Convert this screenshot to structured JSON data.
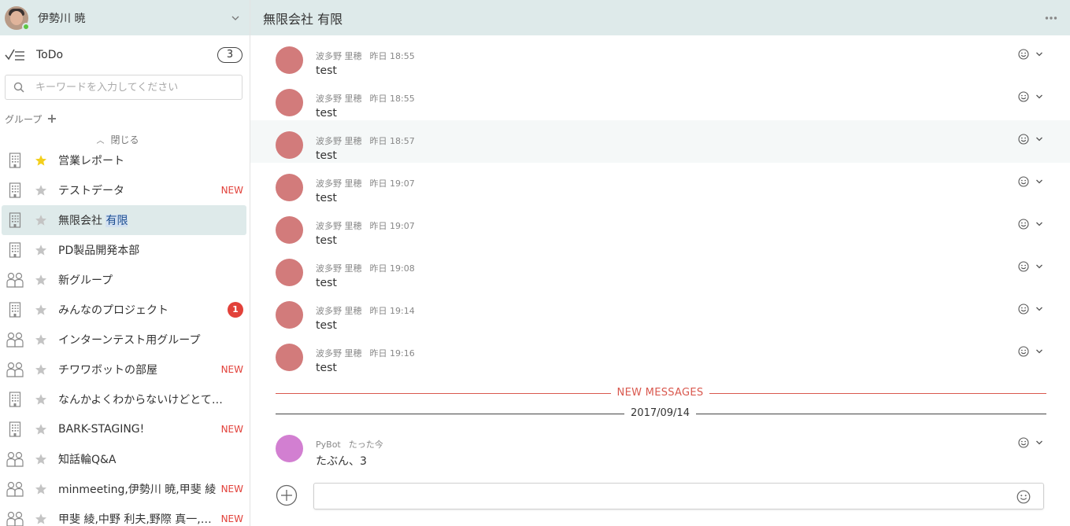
{
  "user": {
    "name": "伊勢川 暁"
  },
  "todo": {
    "label": "ToDo",
    "count": "3"
  },
  "search": {
    "placeholder": "キーワードを入力してください"
  },
  "groups": {
    "label": "グループ",
    "add": "+",
    "collapse_label": "閉じる"
  },
  "rooms": [
    {
      "name": "営業レポート",
      "type": "org",
      "favorite": true,
      "badge": ""
    },
    {
      "name": "テストデータ",
      "type": "org",
      "favorite": false,
      "badge": "NEW"
    },
    {
      "name": "無限会社 有限",
      "type": "org",
      "favorite": false,
      "badge": "",
      "active": true
    },
    {
      "name": "PD製品開発本部",
      "type": "org",
      "favorite": false,
      "badge": ""
    },
    {
      "name": "新グループ",
      "type": "people",
      "favorite": false,
      "badge": ""
    },
    {
      "name": "みんなのプロジェクト",
      "type": "org",
      "favorite": false,
      "badge": "1"
    },
    {
      "name": "インターンテスト用グループ",
      "type": "people",
      "favorite": false,
      "badge": ""
    },
    {
      "name": "チワワボットの部屋",
      "type": "people",
      "favorite": false,
      "badge": "NEW"
    },
    {
      "name": "なんかよくわからないけどとて…",
      "type": "org",
      "favorite": false,
      "badge": ""
    },
    {
      "name": "BARK-STAGING!",
      "type": "org",
      "favorite": false,
      "badge": "NEW"
    },
    {
      "name": "知話輪Q&A",
      "type": "people",
      "favorite": false,
      "badge": ""
    },
    {
      "name": "minmeeting,伊勢川 暁,甲斐 綾",
      "type": "people",
      "favorite": false,
      "badge": "NEW"
    },
    {
      "name": "甲斐 綾,中野 利夫,野際 真一,伊…",
      "type": "people",
      "favorite": false,
      "badge": "NEW"
    }
  ],
  "room": {
    "title": "無限会社 有限",
    "title_part1": "無限会社",
    "title_part2": "有限"
  },
  "messages": [
    {
      "sender": "波多野 里穂",
      "time": "昨日 18:55",
      "text": "test"
    },
    {
      "sender": "波多野 里穂",
      "time": "昨日 18:55",
      "text": "test"
    },
    {
      "sender": "波多野 里穂",
      "time": "昨日 18:57",
      "text": "test"
    },
    {
      "sender": "波多野 里穂",
      "time": "昨日 19:07",
      "text": "test"
    },
    {
      "sender": "波多野 里穂",
      "time": "昨日 19:07",
      "text": "test"
    },
    {
      "sender": "波多野 里穂",
      "time": "昨日 19:08",
      "text": "test"
    },
    {
      "sender": "波多野 里穂",
      "time": "昨日 19:14",
      "text": "test"
    },
    {
      "sender": "波多野 里穂",
      "time": "昨日 19:16",
      "text": "test"
    }
  ],
  "dividers": {
    "new_messages": "NEW MESSAGES",
    "date": "2017/09/14"
  },
  "bot_message": {
    "sender": "PyBot",
    "time": "たった今",
    "text": "たぶん、3"
  },
  "colors": {
    "header_bg": "#deeaea",
    "new_badge": "#e2413a",
    "avatar_user": "#d27b7b",
    "avatar_bot": "#d27fd1",
    "divider_new": "#d9584e"
  }
}
